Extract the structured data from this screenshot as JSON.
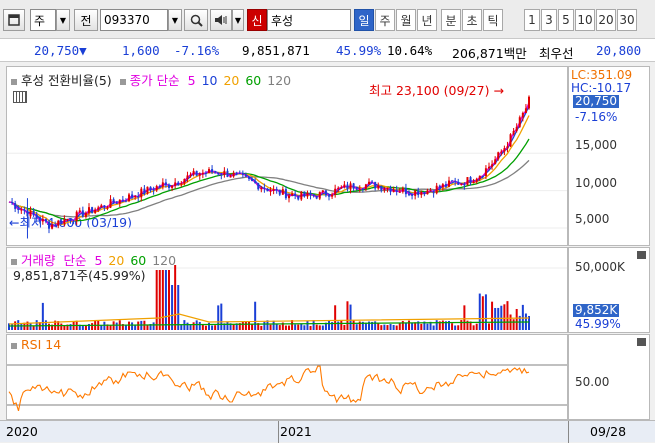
{
  "toolbar": {
    "market": "주",
    "code_label": "전",
    "code": "093370",
    "badge": "신",
    "name": "후성",
    "periods": [
      "일",
      "주",
      "월",
      "년",
      "분",
      "초",
      "틱"
    ],
    "minutes": [
      "1",
      "3",
      "5",
      "10",
      "20",
      "30"
    ]
  },
  "info": {
    "price": "20,750",
    "change": "1,600",
    "rate": "-7.16%",
    "volume": "9,851,871",
    "vol_ratio": "45.99%",
    "turnover": "10.64%",
    "amount": "206,871백만",
    "bid_label": "최우선",
    "bid": "20,800"
  },
  "price_panel": {
    "title": "후성 전환비율(5)",
    "ma_label": "종가 단순",
    "mas": [
      {
        "n": "5",
        "color": "#e000e0"
      },
      {
        "n": "10",
        "color": "#1a3fd6"
      },
      {
        "n": "20",
        "color": "#f0a000"
      },
      {
        "n": "60",
        "color": "#00a000"
      },
      {
        "n": "120",
        "color": "#808080"
      }
    ],
    "high_label": "최고 23,100 (09/27)",
    "low_label": "최저 4,600 (03/19)",
    "axis": {
      "lc": "LC:351.09",
      "hc": "HC:-10.17",
      "price_tag": "20,750",
      "rate_tag": "-7.16%",
      "ticks": [
        "15,000",
        "10,000",
        "5,000"
      ]
    }
  },
  "volume_panel": {
    "title": "거래량",
    "ma_label": "단순",
    "mas": [
      {
        "n": "5",
        "color": "#e000e0"
      },
      {
        "n": "20",
        "color": "#f0a000"
      },
      {
        "n": "60",
        "color": "#00a000"
      },
      {
        "n": "120",
        "color": "#808080"
      }
    ],
    "current": "9,851,871주(45.99%)",
    "axis": {
      "tick": "50,000K",
      "vol_tag": "9,852K",
      "rate_tag": "45.99%"
    }
  },
  "rsi_panel": {
    "title": "RSI 14",
    "axis": {
      "tick": "50.00"
    }
  },
  "x_axis": {
    "labels": [
      "2020",
      "2021"
    ],
    "date": "09/28"
  },
  "colors": {
    "up": "#e00000",
    "down": "#1a3fd6",
    "accent": "#2f65c8",
    "rsi": "#ff7a00"
  }
}
